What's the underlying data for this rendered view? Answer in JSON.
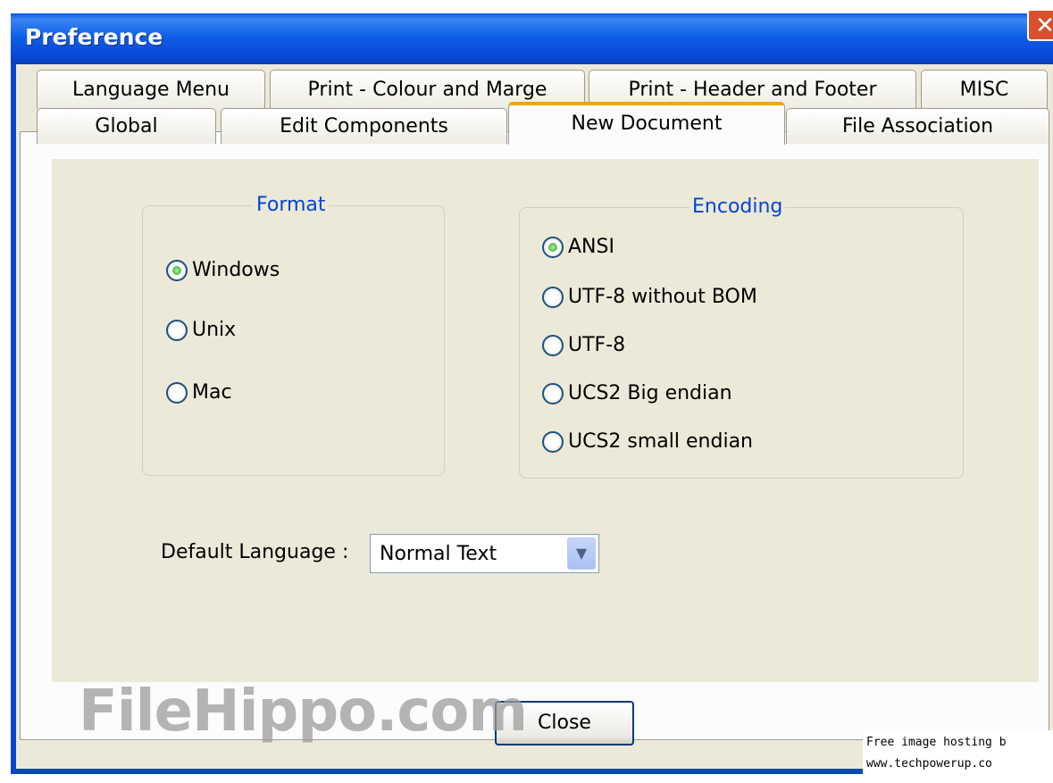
{
  "window": {
    "title": "Preference",
    "close_glyph": "✕"
  },
  "tabs": {
    "row1": [
      "Language Menu",
      "Print - Colour and Marge",
      "Print - Header and Footer",
      "MISC"
    ],
    "row2": [
      "Global",
      "Edit Components",
      "New Document",
      "File Association"
    ],
    "active": "New Document"
  },
  "format": {
    "title": "Format",
    "options": [
      {
        "label": "Windows",
        "selected": true
      },
      {
        "label": "Unix",
        "selected": false
      },
      {
        "label": "Mac",
        "selected": false
      }
    ]
  },
  "encoding": {
    "title": "Encoding",
    "options": [
      {
        "label": "ANSI",
        "selected": true
      },
      {
        "label": "UTF-8 without BOM",
        "selected": false
      },
      {
        "label": "UTF-8",
        "selected": false
      },
      {
        "label": "UCS2 Big endian",
        "selected": false
      },
      {
        "label": "UCS2 small endian",
        "selected": false
      }
    ]
  },
  "default_language": {
    "label": "Default Language :",
    "value": "Normal Text"
  },
  "buttons": {
    "close": "Close"
  },
  "watermark": {
    "text": "FileHippo.com"
  },
  "hosting_note": {
    "line1": "Free image hosting b",
    "line2": "www.techpowerup.co"
  },
  "icons": {
    "dropdown": "chevron-down-icon",
    "radio_on": "radio-checked-icon",
    "radio_off": "radio-unchecked-icon"
  },
  "colors": {
    "titlebar": "#0a5ce4",
    "legend": "#0046d5",
    "active_tab_accent": "#f4a418",
    "dialog_bg": "#ece9d8"
  }
}
